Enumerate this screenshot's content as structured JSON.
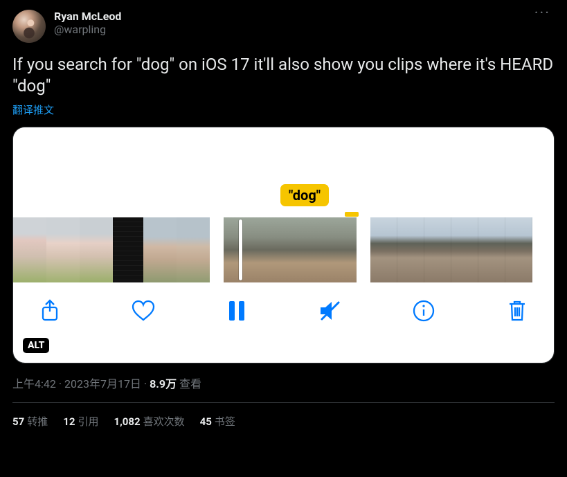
{
  "author": {
    "display_name": "Ryan McLeod",
    "handle": "@warpling"
  },
  "more_label": "···",
  "body": "If you search for \"dog\" on iOS 17 it'll also show you clips where it's HEARD \"dog\"",
  "translate_label": "翻译推文",
  "media": {
    "tag": "\"dog\"",
    "alt_badge": "ALT"
  },
  "meta": {
    "time": "上午4:42",
    "separator1": " · ",
    "date": "2023年7月17日",
    "separator2": " · ",
    "views_count": "8.9万",
    "views_label": " 查看"
  },
  "stats": {
    "retweets": {
      "count": "57",
      "label": "转推"
    },
    "quotes": {
      "count": "12",
      "label": "引用"
    },
    "likes": {
      "count": "1,082",
      "label": "喜欢次数"
    },
    "bookmarks": {
      "count": "45",
      "label": "书签"
    }
  }
}
